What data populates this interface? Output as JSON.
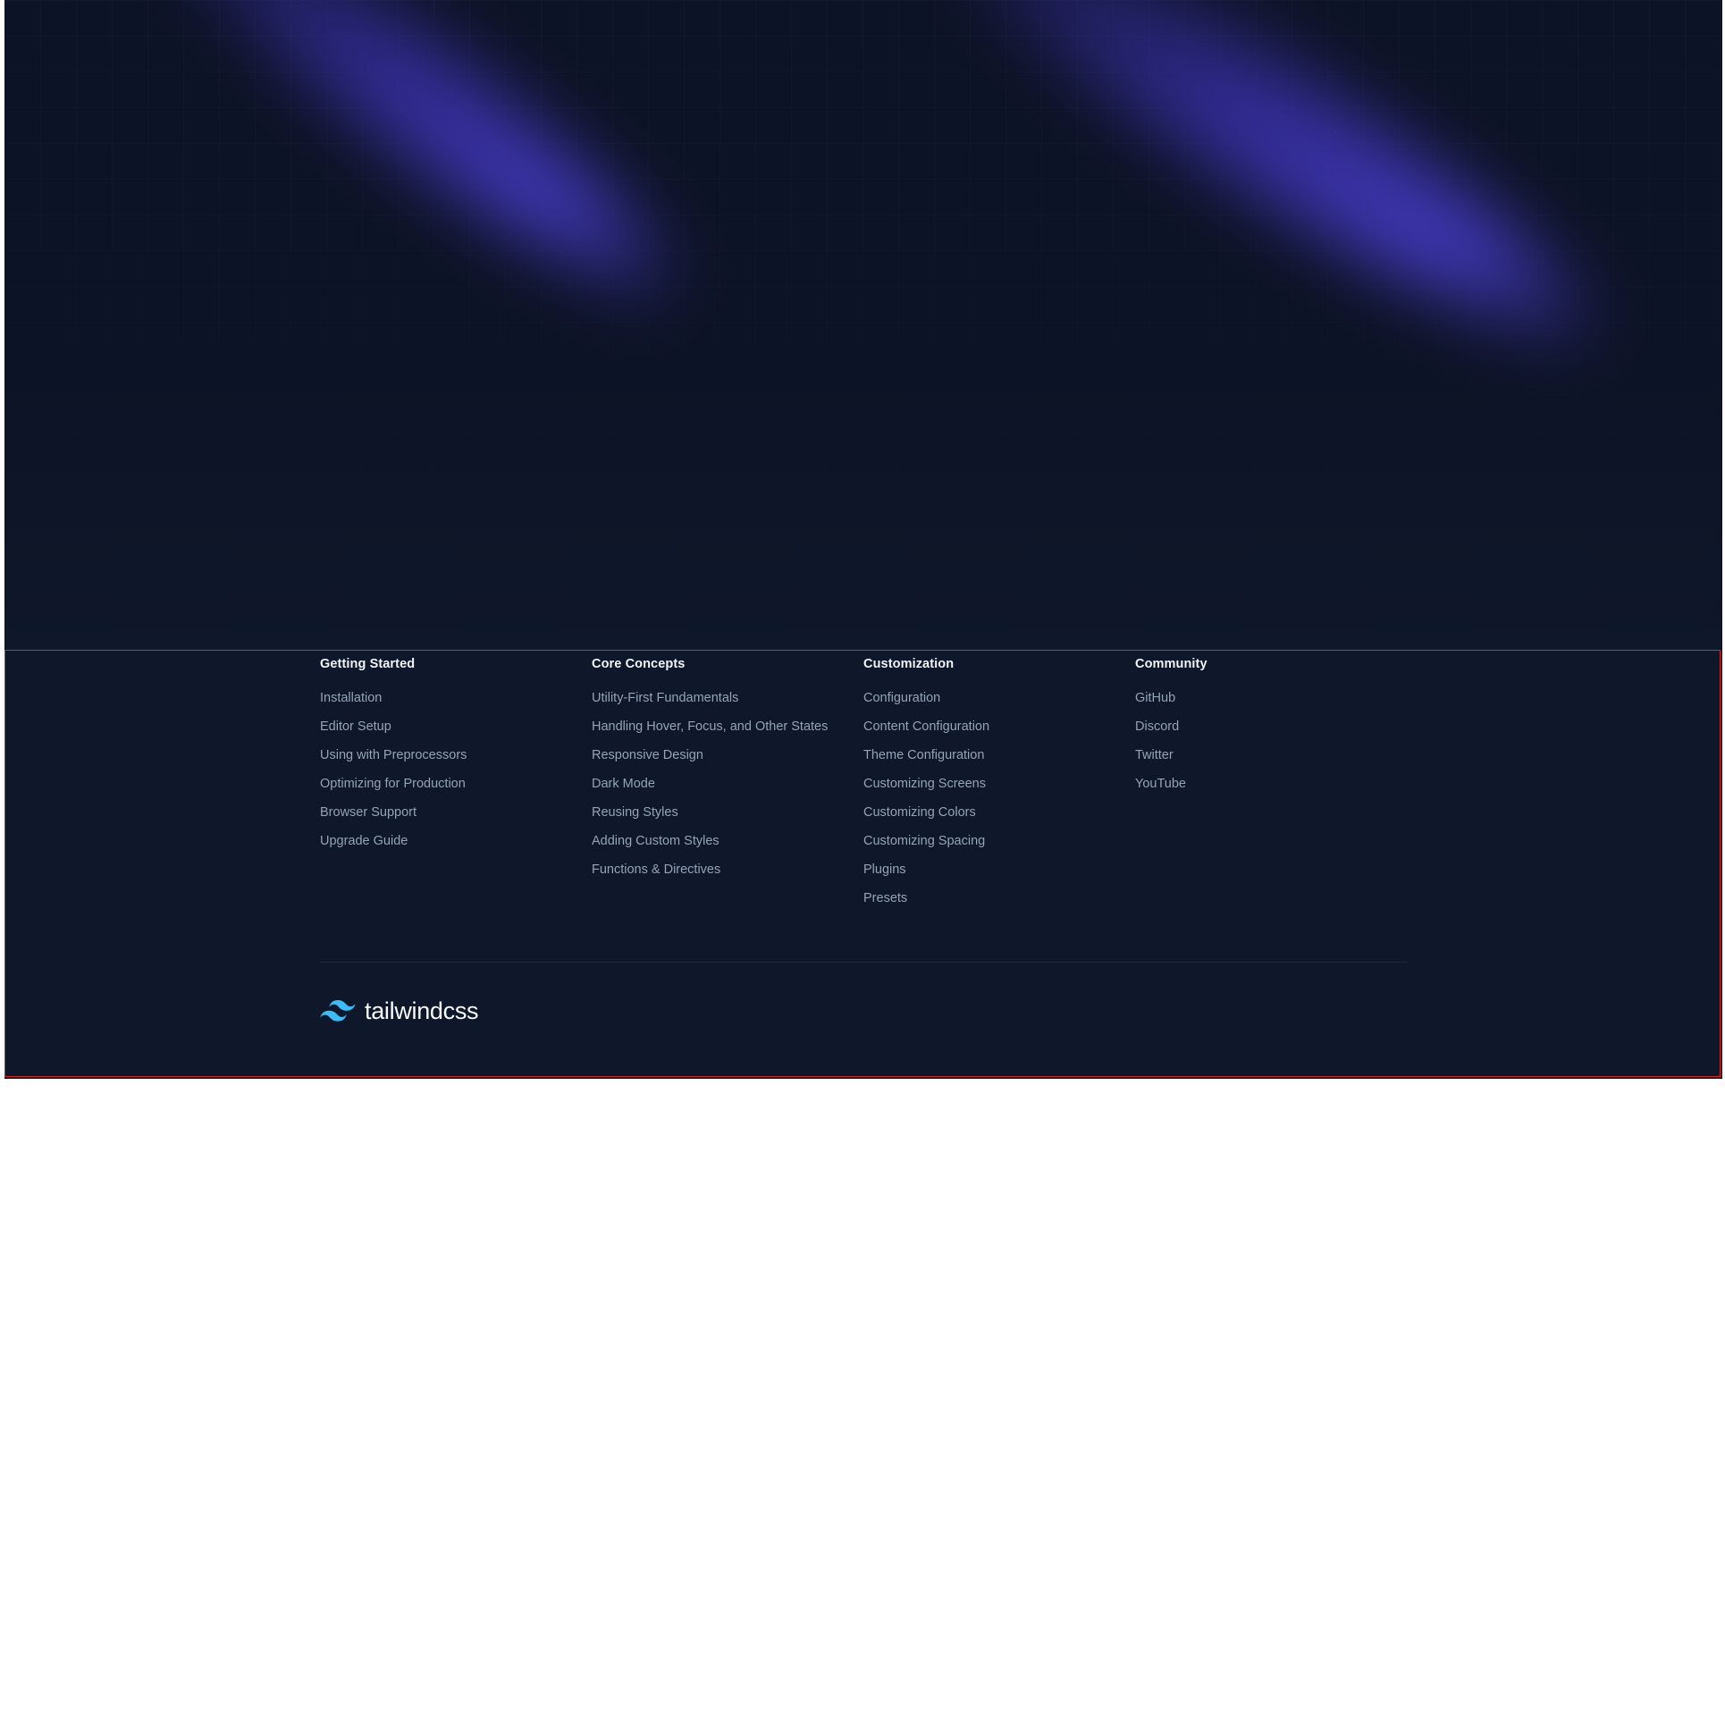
{
  "footer": {
    "columns": [
      {
        "heading": "Getting Started",
        "links": [
          "Installation",
          "Editor Setup",
          "Using with Preprocessors",
          "Optimizing for Production",
          "Browser Support",
          "Upgrade Guide"
        ]
      },
      {
        "heading": "Core Concepts",
        "links": [
          "Utility-First Fundamentals",
          "Handling Hover, Focus, and Other States",
          "Responsive Design",
          "Dark Mode",
          "Reusing Styles",
          "Adding Custom Styles",
          "Functions & Directives"
        ]
      },
      {
        "heading": "Customization",
        "links": [
          "Configuration",
          "Content Configuration",
          "Theme Configuration",
          "Customizing Screens",
          "Customizing Colors",
          "Customizing Spacing",
          "Plugins",
          "Presets"
        ]
      },
      {
        "heading": "Community",
        "links": [
          "GitHub",
          "Discord",
          "Twitter",
          "YouTube"
        ]
      }
    ],
    "brand": {
      "icon": "tailwind-wave-logo-icon",
      "wordmark": "tailwindcss"
    }
  },
  "colors": {
    "background": "#0f172a",
    "heading": "#f1f5f9",
    "link": "#94a3b8",
    "accent": "#38bdf8",
    "glow": "#3730a3",
    "highlight_border": "#dc2626"
  }
}
